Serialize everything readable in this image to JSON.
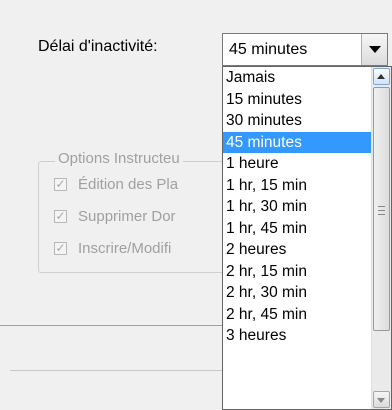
{
  "inactivity": {
    "label": "Délai d'inactivité:",
    "selected_value": "45 minutes"
  },
  "dropdown": {
    "options": [
      "Jamais",
      "15 minutes",
      "30 minutes",
      "45 minutes",
      "1 heure",
      "1 hr, 15 min",
      "1 hr, 30 min",
      "1 hr, 45 min",
      "2 heures",
      "2 hr, 15 min",
      "2 hr, 30 min",
      "2 hr, 45 min",
      "3 heures"
    ],
    "selected_index": 3,
    "selection_color": "#3399ff"
  },
  "instructor_options": {
    "title": "Options Instructeu",
    "items": [
      "Édition des Pla",
      "Supprimer Dor",
      "Inscrire/Modifi"
    ]
  }
}
